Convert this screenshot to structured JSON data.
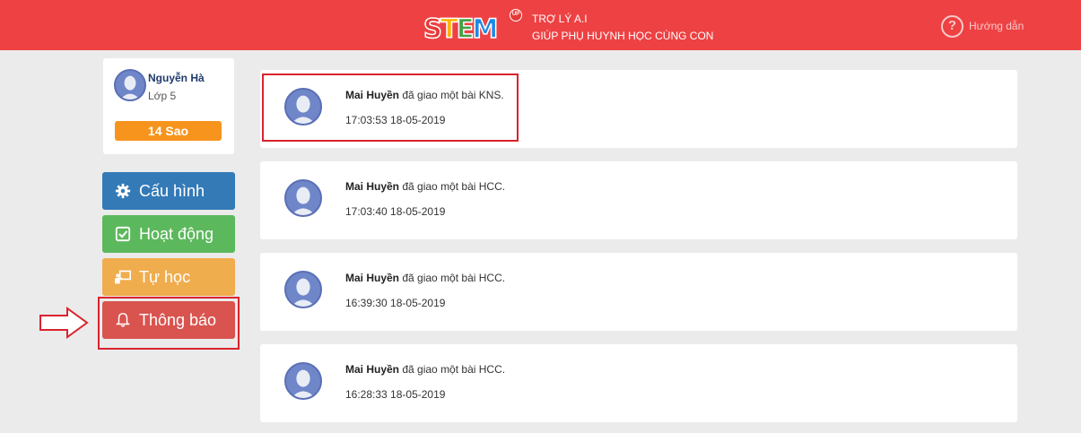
{
  "header": {
    "logo_text": "STEM",
    "logo_badge": "UP",
    "tagline_line1": "TRỢ LÝ A.I",
    "tagline_line2": "GIÚP PHỤ HUYNH HỌC CÙNG CON",
    "help_label": "Hướng dẫn",
    "background": "#ee4143"
  },
  "profile": {
    "name": "Nguyễn Hà",
    "grade": "Lớp 5",
    "stars": "14 Sao"
  },
  "menu": {
    "config": {
      "label": "Cấu hình",
      "icon": "gear-icon",
      "color": "#337ab7"
    },
    "activity": {
      "label": "Hoạt động",
      "icon": "checkbox-icon",
      "color": "#5cb85c"
    },
    "selfstudy": {
      "label": "Tự học",
      "icon": "teacher-board-icon",
      "color": "#f0ad4e"
    },
    "notify": {
      "label": "Thông báo",
      "icon": "bell-icon",
      "color": "#d9534f"
    }
  },
  "notifications": [
    {
      "sender": "Mai Huyền",
      "message": "đã giao một bài KNS.",
      "time": "17:03:53 18-05-2019"
    },
    {
      "sender": "Mai Huyền",
      "message": "đã giao một bài HCC.",
      "time": "17:03:40 18-05-2019"
    },
    {
      "sender": "Mai Huyền",
      "message": "đã giao một bài HCC.",
      "time": "16:39:30 18-05-2019"
    },
    {
      "sender": "Mai Huyền",
      "message": "đã giao một bài HCC.",
      "time": "16:28:33 18-05-2019"
    }
  ],
  "annotation_color": "#d9232d"
}
